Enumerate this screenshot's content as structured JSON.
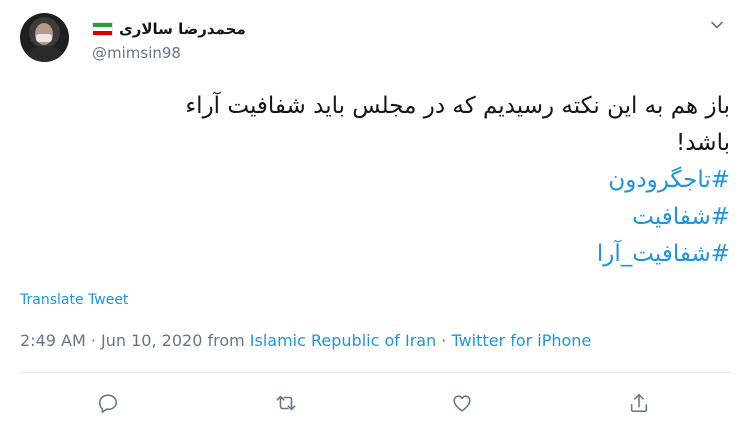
{
  "author": {
    "display_name": "محمدرضا سالاری",
    "handle": "@mimsin98",
    "flag_icon": "iran-flag-icon"
  },
  "tweet": {
    "lines": [
      "باز هم به این نکته رسیدیم که در مجلس باید شفافیت آراء",
      "باشد!"
    ],
    "hashtags": [
      "#تاجگرودون",
      "#شفافیت",
      "#شفافیت_آرا"
    ],
    "translate_label": "Translate Tweet"
  },
  "meta": {
    "time": "2:49 AM",
    "sep1": " · ",
    "date": "Jun 10, 2020",
    "from": " from ",
    "location": "Islamic Republic of Iran",
    "sep2": " · ",
    "client": "Twitter for iPhone"
  },
  "actions": {
    "reply_icon": "reply-icon",
    "retweet_icon": "retweet-icon",
    "like_icon": "like-icon",
    "share_icon": "share-icon"
  },
  "colors": {
    "link": "#1b95e0",
    "muted": "#657786",
    "text": "#14171a"
  }
}
